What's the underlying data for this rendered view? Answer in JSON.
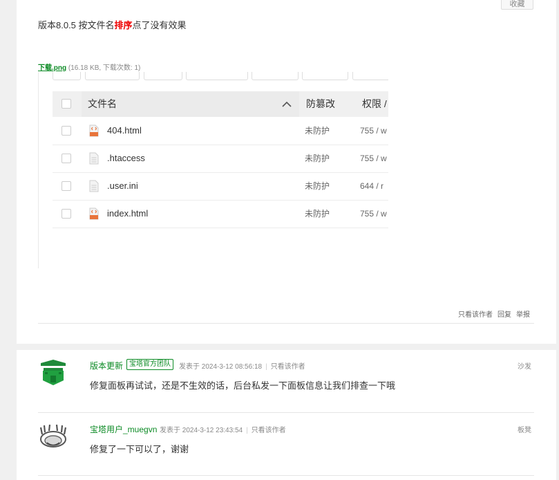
{
  "post": {
    "favorite_label": "收藏",
    "text_before": "版本8.0.5 按文件名",
    "text_highlight": "排序",
    "text_after": "点了没有效果",
    "attachment_name": "下载.png",
    "attachment_info": "(16.18 KB, 下载次数: 1)",
    "actions": {
      "only_author": "只看该作者",
      "reply": "回复",
      "report": "举报"
    }
  },
  "screenshot": {
    "headers": {
      "filename": "文件名",
      "tamper": "防篡改",
      "permission": "权限 /"
    },
    "files": [
      {
        "name": "404.html",
        "icon": "html-file-icon",
        "protect": "未防护",
        "perm": "755 / w"
      },
      {
        "name": ".htaccess",
        "icon": "text-file-icon",
        "protect": "未防护",
        "perm": "755 / w"
      },
      {
        "name": ".user.ini",
        "icon": "text-file-icon",
        "protect": "未防护",
        "perm": "644 / r"
      },
      {
        "name": "index.html",
        "icon": "html-file-icon",
        "protect": "未防护",
        "perm": "755 / w"
      }
    ]
  },
  "replies": [
    {
      "author": "版本更新",
      "badge": "宝塔官方团队",
      "meta": "发表于 2024-3-12 08:56:18",
      "only_author": "只看该作者",
      "floor": "沙发",
      "text": "修复面板再试试，还是不生效的话，后台私发一下面板信息让我们排查一下哦",
      "avatar_icon": "bt-team-avatar-icon"
    },
    {
      "author": "宝塔用户_muegvn",
      "meta": "发表于 2024-3-12 23:43:54",
      "only_author": "只看该作者",
      "floor": "板凳",
      "text": "修复了一下可以了，谢谢",
      "avatar_icon": "user-avatar-icon"
    }
  ],
  "colors": {
    "accent": "#0b8a24",
    "highlight": "#e00000",
    "page_bg": "#f0f0f0"
  }
}
